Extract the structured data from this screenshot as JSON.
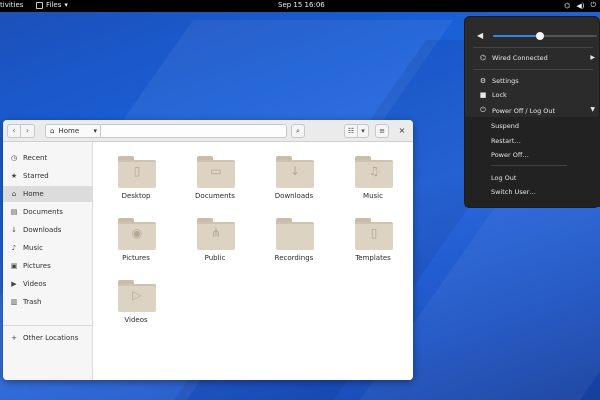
{
  "topbar": {
    "activities": "tivities",
    "app_menu": "Files",
    "clock": "Sep 15  16:06",
    "status_icons": [
      "network-icon",
      "volume-icon",
      "power-icon"
    ]
  },
  "system_menu": {
    "volume_level": 0.45,
    "network_label": "Wired Connected",
    "settings_label": "Settings",
    "lock_label": "Lock",
    "power_label": "Power Off / Log Out",
    "submenu": [
      "Suspend",
      "Restart…",
      "Power Off…",
      "Log Out",
      "Switch User…"
    ]
  },
  "window": {
    "path_home": "Home",
    "sidebar": [
      {
        "label": "Recent",
        "icon": "clock-icon",
        "glyph": "◷"
      },
      {
        "label": "Starred",
        "icon": "star-icon",
        "glyph": "★"
      },
      {
        "label": "Home",
        "icon": "home-icon",
        "glyph": "⌂"
      },
      {
        "label": "Documents",
        "icon": "document-icon",
        "glyph": "▤"
      },
      {
        "label": "Downloads",
        "icon": "download-icon",
        "glyph": "↓"
      },
      {
        "label": "Music",
        "icon": "music-icon",
        "glyph": "♪"
      },
      {
        "label": "Pictures",
        "icon": "picture-icon",
        "glyph": "▣"
      },
      {
        "label": "Videos",
        "icon": "video-icon",
        "glyph": "▶"
      },
      {
        "label": "Trash",
        "icon": "trash-icon",
        "glyph": "▥"
      }
    ],
    "other_locations": "Other Locations",
    "folders": [
      {
        "label": "Desktop",
        "icon": "desktop-icon",
        "glyph": "▯"
      },
      {
        "label": "Documents",
        "icon": "document-icon",
        "glyph": "▭"
      },
      {
        "label": "Downloads",
        "icon": "download-icon",
        "glyph": "↓"
      },
      {
        "label": "Music",
        "icon": "music-icon",
        "glyph": "♫"
      },
      {
        "label": "Pictures",
        "icon": "camera-icon",
        "glyph": "◉"
      },
      {
        "label": "Public",
        "icon": "share-icon",
        "glyph": "⋔"
      },
      {
        "label": "Recordings",
        "icon": "recordings-icon",
        "glyph": ""
      },
      {
        "label": "Templates",
        "icon": "template-icon",
        "glyph": "▯"
      },
      {
        "label": "Videos",
        "icon": "video-icon",
        "glyph": "▷"
      }
    ]
  }
}
